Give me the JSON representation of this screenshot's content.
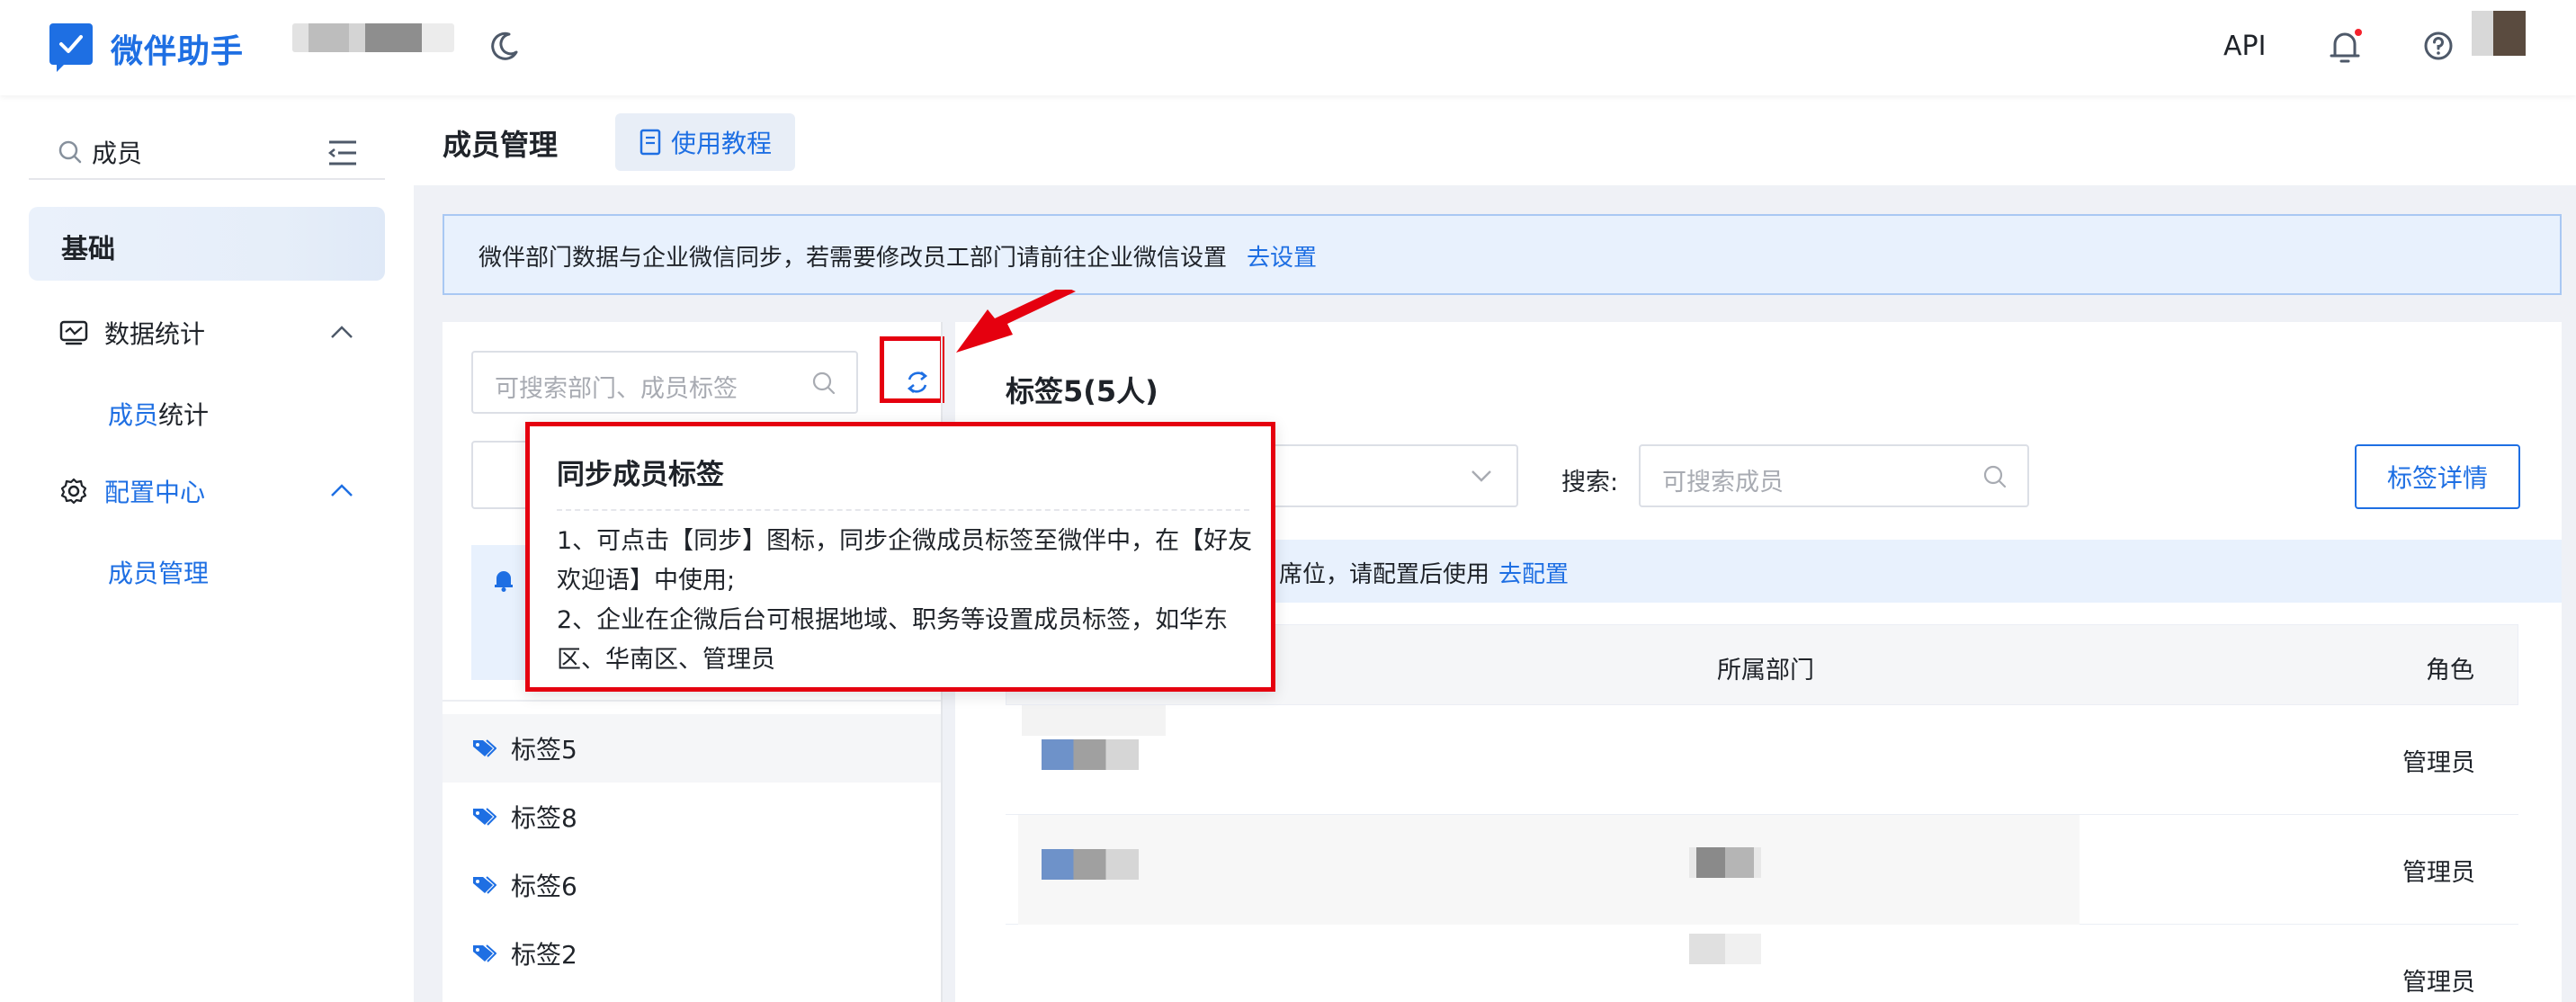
{
  "header": {
    "brand": "微伴助手",
    "api_label": "API",
    "accent": "#1e6fe3"
  },
  "sidebar": {
    "search_value": "成员",
    "active_section": "基础",
    "groups": [
      {
        "label": "数据统计",
        "icon": "chart-monitor-icon",
        "sub_highlight": "成员",
        "sub_rest": "统计"
      },
      {
        "label": "配置中心",
        "icon": "gear-icon",
        "sub": "成员管理"
      }
    ]
  },
  "page": {
    "title": "成员管理",
    "tutorial_label": "使用教程"
  },
  "notice": {
    "text": "微伴部门数据与企业微信同步，若需要修改员工部门请前往企业微信设置",
    "link": "去设置"
  },
  "left_panel": {
    "search_placeholder": "可搜索部门、成员标签",
    "tags": [
      "标签5",
      "标签8",
      "标签6",
      "标签2"
    ]
  },
  "right_panel": {
    "title": "标签5(5人)",
    "search_label": "搜索:",
    "search_placeholder": "可搜索成员",
    "detail_button": "标签详情",
    "info_text": "基础版】席位，请配置后使用",
    "info_link": "去配置",
    "columns": [
      "所属部门",
      "角色"
    ],
    "rows": [
      {
        "role": "管理员"
      },
      {
        "role": "管理员"
      },
      {
        "role": "管理员"
      }
    ]
  },
  "tooltip": {
    "title": "同步成员标签",
    "line1": "1、可点击【同步】图标，同步企微成员标签至微伴中，在【好友欢迎语】中使用;",
    "line2": "2、企业在企微后台可根据地域、职务等设置成员标签，如华东区、华南区、管理员"
  },
  "annotation_color": "#e5000f"
}
